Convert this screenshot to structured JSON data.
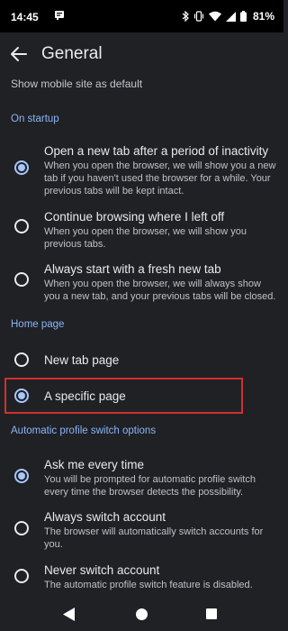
{
  "status_bar": {
    "time": "14:45",
    "battery": "81%",
    "icons": [
      "notification-icon",
      "bluetooth-icon",
      "vibrate-icon",
      "wifi-icon",
      "signal-icon",
      "battery-icon"
    ]
  },
  "app_bar": {
    "title": "General"
  },
  "partial_item": {
    "description": "Show mobile site as default"
  },
  "on_startup": {
    "label": "On startup",
    "options": [
      {
        "title": "Open a new tab after a period of inactivity",
        "desc": "When you open the browser, we will show you a new tab if you haven't used the browser for a while. Your previous tabs will be kept intact.",
        "checked": true
      },
      {
        "title": "Continue browsing where I left off",
        "desc": "When you open the browser, we will show you previous tabs.",
        "checked": false
      },
      {
        "title": "Always start with a fresh new tab",
        "desc": "When you open the browser, we will always show you a new tab, and your previous tabs will be closed.",
        "checked": false
      }
    ]
  },
  "home_page": {
    "label": "Home page",
    "options": [
      {
        "title": "New tab page",
        "checked": false
      },
      {
        "title": "A specific page",
        "checked": true
      }
    ]
  },
  "profile_switch": {
    "label": "Automatic profile switch options",
    "options": [
      {
        "title": "Ask me every time",
        "desc": "You will be prompted for automatic profile switch every time the browser detects the possibility.",
        "checked": true
      },
      {
        "title": "Always switch account",
        "desc": "The browser will automatically switch accounts for you.",
        "checked": false
      },
      {
        "title": "Never switch account",
        "desc": "The automatic profile switch feature is disabled.",
        "checked": false
      }
    ]
  },
  "colors": {
    "accent": "#8ab4f8",
    "radio_checked": "#a8c7fa",
    "highlight": "#d32f2f",
    "background": "#202124"
  }
}
